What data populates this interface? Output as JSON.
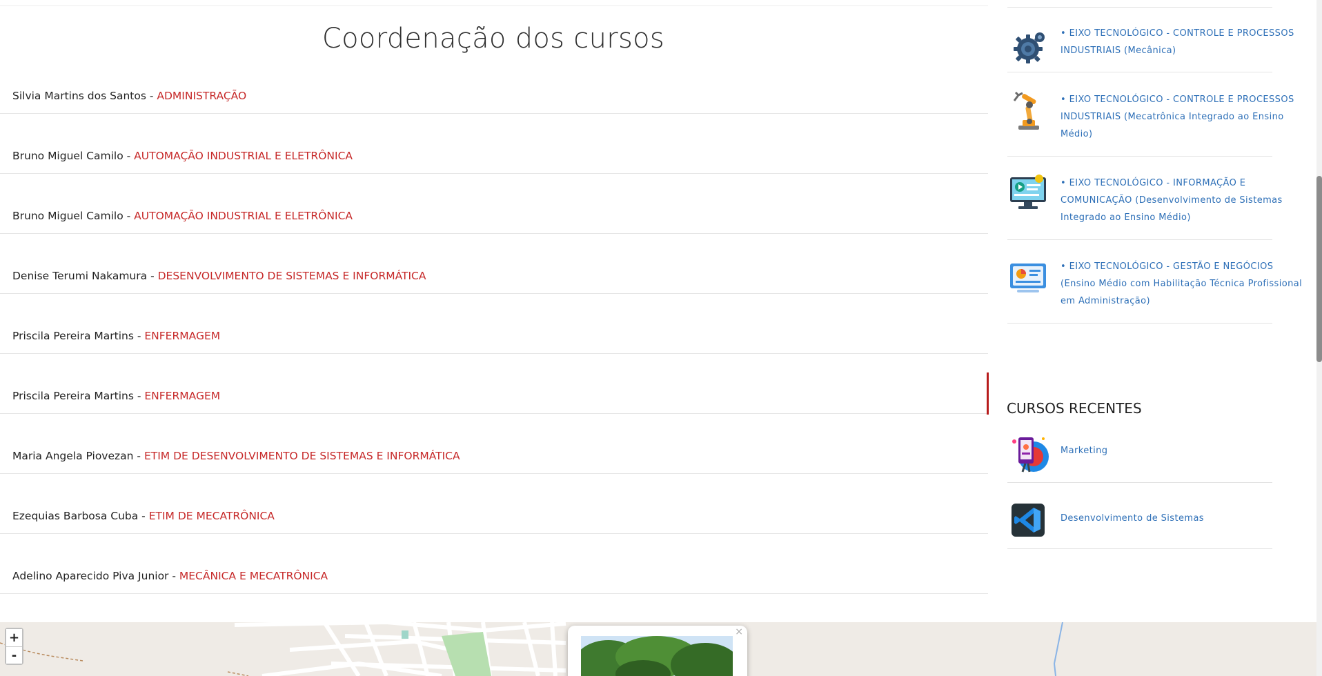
{
  "main": {
    "title": "Coordenação dos cursos",
    "coordinators": [
      {
        "name": "Silvia Martins dos Santos",
        "sep": " - ",
        "course": "ADMINISTRAÇÃO"
      },
      {
        "name": "Bruno Miguel Camilo",
        "sep": " - ",
        "course": "AUTOMAÇÃO INDUSTRIAL E ELETRÔNICA"
      },
      {
        "name": "Bruno Miguel Camilo",
        "sep": " - ",
        "course": "AUTOMAÇÃO INDUSTRIAL E ELETRÔNICA"
      },
      {
        "name": "Denise Terumi Nakamura",
        "sep": " - ",
        "course": "DESENVOLVIMENTO DE SISTEMAS E INFORMÁTICA"
      },
      {
        "name": "Priscila Pereira Martins",
        "sep": " - ",
        "course": "ENFERMAGEM"
      },
      {
        "name": "Priscila Pereira Martins",
        "sep": " - ",
        "course": "ENFERMAGEM"
      },
      {
        "name": "Maria Angela Piovezan",
        "sep": " - ",
        "course": "ETIM DE DESENVOLVIMENTO DE SISTEMAS E INFORMÁTICA"
      },
      {
        "name": "Ezequias Barbosa Cuba",
        "sep": " - ",
        "course": "ETIM DE MECATRÔNICA"
      },
      {
        "name": "Adelino Aparecido Piva Junior",
        "sep": " - ",
        "course": "MECÂNICA E MECATRÔNICA"
      }
    ]
  },
  "sidebar": {
    "eixos": [
      {
        "label": "• EIXO TECNOLÓGICO - CONTROLE E PROCESSOS INDUSTRIAIS (Mecânica)",
        "icon": "gear-icon"
      },
      {
        "label": "• EIXO TECNOLÓGICO - CONTROLE E PROCESSOS INDUSTRIAIS (Mecatrônica Integrado ao Ensino Médio)",
        "icon": "robot-arm-icon"
      },
      {
        "label": "• EIXO TECNOLÓGICO - INFORMAÇÃO E COMUNICAÇÃO (Desenvolvimento de Sistemas Integrado ao Ensino Médio)",
        "icon": "computer-screen-icon"
      },
      {
        "label": "• EIXO TECNOLÓGICO - GESTÃO E NEGÓCIOS (Ensino Médio com Habilitação Técnica Profissional em Administração)",
        "icon": "dashboard-icon"
      }
    ],
    "recent_title": "CURSOS RECENTES",
    "recent": [
      {
        "label": "Marketing",
        "icon": "marketing-icon"
      },
      {
        "label": "Desenvolvimento de Sistemas",
        "icon": "vscode-icon"
      }
    ]
  },
  "map": {
    "zoom_in": "+",
    "zoom_out": "-",
    "popup_close": "×"
  },
  "colors": {
    "accent_red": "#c62828",
    "link_blue": "#2d6fb7"
  }
}
